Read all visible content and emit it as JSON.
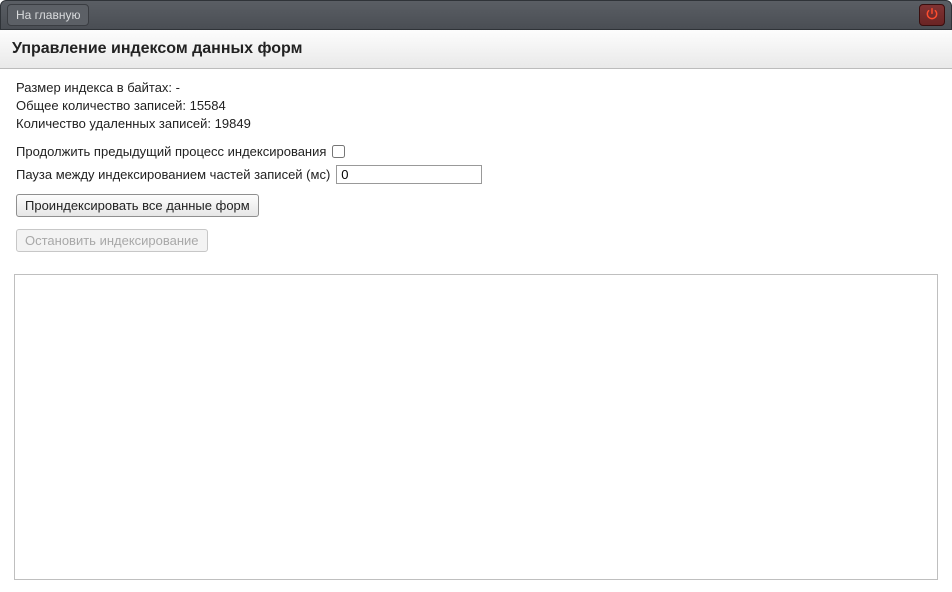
{
  "topbar": {
    "home_label": "На главную"
  },
  "page": {
    "title": "Управление индексом данных форм"
  },
  "stats": {
    "index_size_label": "Размер индекса в байтах:",
    "index_size_value": "-",
    "total_records_label": "Общее количество записей:",
    "total_records_value": "15584",
    "deleted_records_label": "Количество удаленных записей:",
    "deleted_records_value": "19849"
  },
  "form": {
    "continue_label": "Продолжить предыдущий процесс индексирования",
    "continue_checked": false,
    "pause_label": "Пауза между индексированием частей записей (мс)",
    "pause_value": "0",
    "index_button": "Проиндексировать все данные форм",
    "stop_button": "Остановить индексирование"
  },
  "log": {
    "content": ""
  }
}
